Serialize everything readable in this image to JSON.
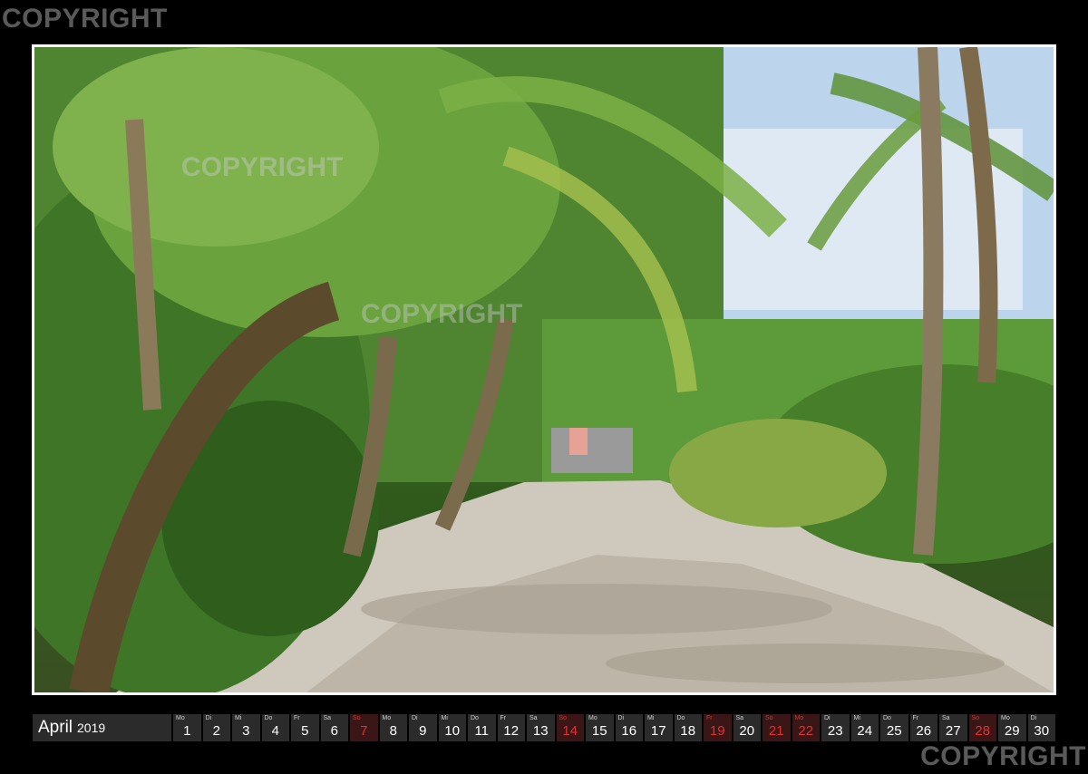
{
  "watermarks": {
    "top_left": "COPYRIGHT",
    "bottom_right": "COPYRIGHT",
    "photo_1": "COPYRIGHT",
    "photo_2": "COPYRIGHT"
  },
  "calendar": {
    "month": "April",
    "year": "2019",
    "days": [
      {
        "dn": "Mo",
        "d": "1",
        "red": false
      },
      {
        "dn": "Di",
        "d": "2",
        "red": false
      },
      {
        "dn": "Mi",
        "d": "3",
        "red": false
      },
      {
        "dn": "Do",
        "d": "4",
        "red": false
      },
      {
        "dn": "Fr",
        "d": "5",
        "red": false
      },
      {
        "dn": "Sa",
        "d": "6",
        "red": false
      },
      {
        "dn": "So",
        "d": "7",
        "red": true
      },
      {
        "dn": "Mo",
        "d": "8",
        "red": false
      },
      {
        "dn": "Di",
        "d": "9",
        "red": false
      },
      {
        "dn": "Mi",
        "d": "10",
        "red": false
      },
      {
        "dn": "Do",
        "d": "11",
        "red": false
      },
      {
        "dn": "Fr",
        "d": "12",
        "red": false
      },
      {
        "dn": "Sa",
        "d": "13",
        "red": false
      },
      {
        "dn": "So",
        "d": "14",
        "red": true
      },
      {
        "dn": "Mo",
        "d": "15",
        "red": false
      },
      {
        "dn": "Di",
        "d": "16",
        "red": false
      },
      {
        "dn": "Mi",
        "d": "17",
        "red": false
      },
      {
        "dn": "Do",
        "d": "18",
        "red": false
      },
      {
        "dn": "Fr",
        "d": "19",
        "red": true
      },
      {
        "dn": "Sa",
        "d": "20",
        "red": false
      },
      {
        "dn": "So",
        "d": "21",
        "red": true
      },
      {
        "dn": "Mo",
        "d": "22",
        "red": true
      },
      {
        "dn": "Di",
        "d": "23",
        "red": false
      },
      {
        "dn": "Mi",
        "d": "24",
        "red": false
      },
      {
        "dn": "Do",
        "d": "25",
        "red": false
      },
      {
        "dn": "Fr",
        "d": "26",
        "red": false
      },
      {
        "dn": "Sa",
        "d": "27",
        "red": false
      },
      {
        "dn": "So",
        "d": "28",
        "red": true
      },
      {
        "dn": "Mo",
        "d": "29",
        "red": false
      },
      {
        "dn": "Di",
        "d": "30",
        "red": false
      }
    ]
  },
  "colors": {
    "background": "#000000",
    "bar": "#2b2b2b",
    "holiday_red": "#e03030"
  }
}
